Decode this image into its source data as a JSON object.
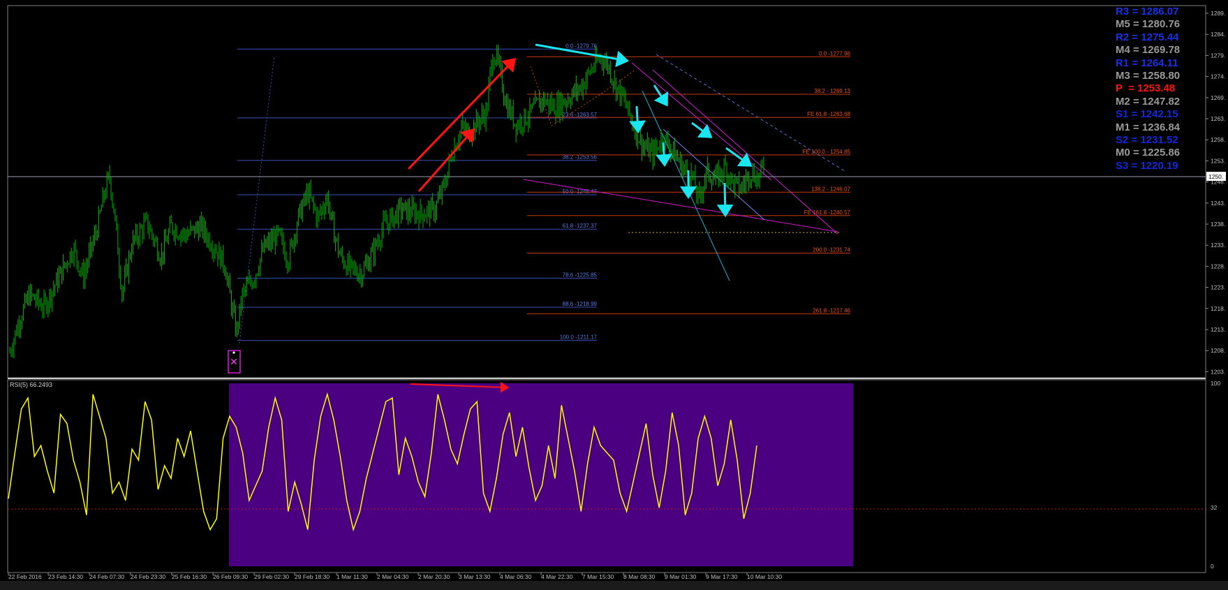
{
  "colors": {
    "background": "#000000",
    "candles": "#00b400",
    "grid_text": "#c0c0c0",
    "fib_retracement": "#3b4fb8",
    "fib_expansion": "#c83a10",
    "rsi_line": "#ffff00",
    "rsi_zone": "#4b0082",
    "arrow_red": "#ff1414",
    "arrow_cyan": "#19e6f0",
    "trendline_magenta": "#d21ed2",
    "resistance": "#ffffff",
    "support": "#1428dc",
    "pivot": "#ff1414",
    "mid": "#9a9a9a"
  },
  "chart_data": [
    {
      "type": "candlestick",
      "title": "",
      "price_axis": {
        "ticks": [
          "1289.",
          "1284.",
          "1279.",
          "1274.",
          "1269.",
          "1263.",
          "1258.",
          "1253.",
          "1248.",
          "1243.",
          "1238.",
          "1233.",
          "1228.",
          "1223.",
          "1218.",
          "1213.",
          "1208.",
          "1203."
        ],
        "current_price_label": "1250.",
        "current_price": 1250.2,
        "ylim": [
          1202.4,
          1290
        ]
      },
      "time_axis": {
        "ticks": [
          "22 Feb 2016",
          "23 Feb 14:30",
          "24 Feb 07:30",
          "24 Feb 23:30",
          "25 Feb 16:30",
          "26 Feb 09:30",
          "29 Feb 02:30",
          "29 Feb 18:30",
          "1 Mar 11:30",
          "2 Mar 04:30",
          "2 Mar 20:30",
          "3 Mar 13:30",
          "4 Mar 06:30",
          "4 Mar 22:30",
          "7 Mar 15:30",
          "8 Mar 08:30",
          "9 Mar 01:30",
          "9 Mar 17:30",
          "10 Mar 10:30"
        ]
      },
      "price_path": [
        [
          0,
          1208.5
        ],
        [
          10,
          1216
        ],
        [
          20,
          1222
        ],
        [
          35,
          1219
        ],
        [
          50,
          1226
        ],
        [
          65,
          1233
        ],
        [
          75,
          1226
        ],
        [
          90,
          1238
        ],
        [
          96,
          1245
        ],
        [
          102,
          1250
        ],
        [
          108,
          1239
        ],
        [
          115,
          1222
        ],
        [
          125,
          1234
        ],
        [
          140,
          1239
        ],
        [
          155,
          1231
        ],
        [
          165,
          1238
        ],
        [
          180,
          1236
        ],
        [
          195,
          1238
        ],
        [
          210,
          1233
        ],
        [
          220,
          1229
        ],
        [
          228,
          1218
        ],
        [
          232,
          1213
        ],
        [
          238,
          1222
        ],
        [
          250,
          1226
        ],
        [
          260,
          1233
        ],
        [
          275,
          1236
        ],
        [
          285,
          1230
        ],
        [
          295,
          1240
        ],
        [
          305,
          1246
        ],
        [
          315,
          1240
        ],
        [
          325,
          1245
        ],
        [
          330,
          1238
        ],
        [
          338,
          1231
        ],
        [
          348,
          1228
        ],
        [
          360,
          1227
        ],
        [
          372,
          1232
        ],
        [
          382,
          1238
        ],
        [
          400,
          1242
        ],
        [
          420,
          1241
        ],
        [
          435,
          1242
        ],
        [
          445,
          1248
        ],
        [
          452,
          1255
        ],
        [
          462,
          1261
        ],
        [
          470,
          1260
        ],
        [
          480,
          1263
        ],
        [
          488,
          1265
        ],
        [
          492,
          1275
        ],
        [
          496,
          1279
        ],
        [
          500,
          1276
        ],
        [
          508,
          1267
        ],
        [
          518,
          1262
        ],
        [
          530,
          1264
        ],
        [
          545,
          1268
        ],
        [
          558,
          1266
        ],
        [
          570,
          1268
        ],
        [
          585,
          1271
        ],
        [
          595,
          1275
        ],
        [
          605,
          1278
        ],
        [
          612,
          1276
        ],
        [
          620,
          1271
        ],
        [
          628,
          1268
        ],
        [
          638,
          1262
        ],
        [
          648,
          1257
        ],
        [
          658,
          1255
        ],
        [
          668,
          1259
        ],
        [
          678,
          1256
        ],
        [
          688,
          1252
        ],
        [
          698,
          1250
        ],
        [
          705,
          1244
        ],
        [
          713,
          1251
        ],
        [
          722,
          1249
        ],
        [
          732,
          1252
        ],
        [
          740,
          1248
        ],
        [
          748,
          1247
        ],
        [
          758,
          1251
        ],
        [
          766,
          1249
        ],
        [
          772,
          1253
        ]
      ],
      "fib_retracement": {
        "high": 1279.76,
        "low": 1211.17,
        "levels": [
          {
            "label": "0.0 -1279.76",
            "price": 1279.76
          },
          {
            "label": "23.6 -1263.57",
            "price": 1263.57
          },
          {
            "label": "38.2 -1253.56",
            "price": 1253.56
          },
          {
            "label": "50.0 -1245.47",
            "price": 1245.47
          },
          {
            "label": "61.8 -1237.37",
            "price": 1237.37
          },
          {
            "label": "78.6 -1225.85",
            "price": 1225.85
          },
          {
            "label": "88.6 -1218.99",
            "price": 1218.99
          },
          {
            "label": "100.0 -1211.17",
            "price": 1211.17
          }
        ]
      },
      "fib_expansion": {
        "levels": [
          {
            "label": "0.0 -1277.96",
            "price": 1277.96
          },
          {
            "label": "38.2 - 1269.13",
            "price": 1269.13
          },
          {
            "label": "FE 61.8 -1263.68",
            "price": 1263.68
          },
          {
            "label": "FE 100.0 - 1254.85",
            "price": 1254.85
          },
          {
            "label": "138.2 - 1246.07",
            "price": 1246.07
          },
          {
            "label": "FE 161.8 -1240.57",
            "price": 1240.57
          },
          {
            "label": "200.0 -1231.74",
            "price": 1231.74
          },
          {
            "label": "261.8 -1217.46",
            "price": 1217.46
          }
        ]
      },
      "pivot_levels": [
        {
          "label": "R3 = 1286.07",
          "kind": "resistance"
        },
        {
          "label": "M5 = 1280.76",
          "kind": "mid"
        },
        {
          "label": "R2 = 1275.44",
          "kind": "resistance"
        },
        {
          "label": "M4 = 1269.78",
          "kind": "mid"
        },
        {
          "label": "R1 = 1264.11",
          "kind": "resistance"
        },
        {
          "label": "M3 = 1258.80",
          "kind": "mid"
        },
        {
          "label": "P  = 1253.48",
          "kind": "pivot"
        },
        {
          "label": "M2 = 1247.82",
          "kind": "mid"
        },
        {
          "label": "S1 = 1242.15",
          "kind": "support"
        },
        {
          "label": "M1 = 1236.84",
          "kind": "mid"
        },
        {
          "label": "S2 = 1231.52",
          "kind": "support"
        },
        {
          "label": "M0 = 1225.86",
          "kind": "mid"
        },
        {
          "label": "S3 = 1220.19",
          "kind": "support"
        }
      ]
    },
    {
      "type": "line",
      "title": "RSI(5) 66.2493",
      "period": 5,
      "last_value": 66.2493,
      "y_ticks": [
        "100",
        "32",
        "0"
      ],
      "ylim": [
        0,
        100
      ],
      "reference_level": 32,
      "series": [
        {
          "values": [
            37,
            62,
            86,
            92,
            60,
            66,
            52,
            40,
            83,
            78,
            58,
            46,
            28,
            94,
            82,
            70,
            40,
            46,
            36,
            64,
            58,
            90,
            80,
            42,
            55,
            48,
            70,
            60,
            74,
            52,
            30,
            20,
            26,
            70,
            82,
            76,
            62,
            36,
            44,
            52,
            76,
            92,
            80,
            30,
            46,
            34,
            20,
            58,
            82,
            94,
            80,
            60,
            36,
            20,
            30,
            48,
            62,
            76,
            90,
            92,
            50,
            70,
            60,
            46,
            38,
            62,
            94,
            80,
            64,
            56,
            72,
            86,
            90,
            40,
            30,
            48,
            72,
            84,
            60,
            76,
            54,
            36,
            44,
            66,
            48,
            88,
            70,
            52,
            30,
            56,
            76,
            66,
            62,
            58,
            40,
            30,
            46,
            62,
            78,
            50,
            32,
            52,
            84,
            66,
            28,
            40,
            70,
            82,
            70,
            44,
            56,
            80,
            58,
            26,
            40,
            66
          ]
        }
      ]
    }
  ]
}
